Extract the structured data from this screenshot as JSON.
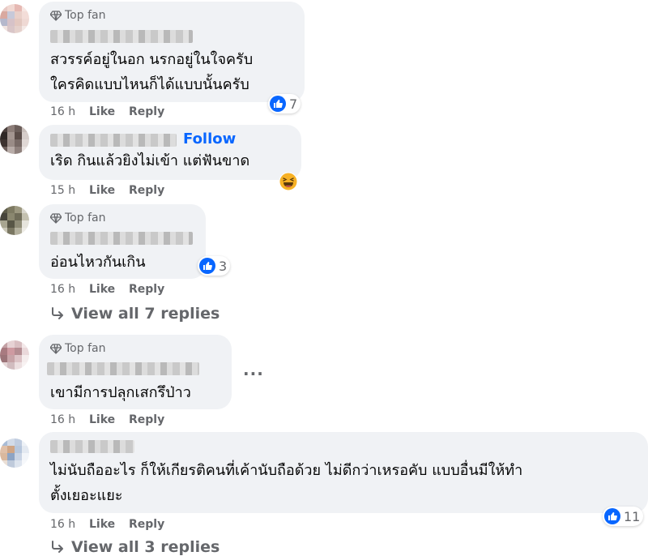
{
  "colors": {
    "bubble": "#f0f2f5",
    "accent": "#0866ff",
    "muted": "#65676b"
  },
  "comments": [
    {
      "badge": "Top fan",
      "lines": [
        "สวรรค์อยู่ในอก นรกอยู่ในใจครับ",
        "ใครคิดแบบไหนก็ได้แบบนั้นครับ"
      ],
      "time": "16 h",
      "like": "Like",
      "reply": "Reply",
      "reactions": "7"
    },
    {
      "follow": "Follow",
      "lines": [
        "เริด กินแล้วยิงไม่เข้า แต่ฟันขาด"
      ],
      "time": "15 h",
      "like": "Like",
      "reply": "Reply",
      "reaction_icon": "haha-emoji-icon"
    },
    {
      "badge": "Top fan",
      "lines": [
        "อ่อนไหวกันเกิน"
      ],
      "time": "16 h",
      "like": "Like",
      "reply": "Reply",
      "reactions": "3",
      "view_replies": "View all 7 replies"
    },
    {
      "badge": "Top fan",
      "lines": [
        "เขามีการปลุกเสกรึป่าว"
      ],
      "time": "16 h",
      "like": "Like",
      "reply": "Reply",
      "more": "..."
    },
    {
      "lines": [
        "ไม่นับถืออะไร ก็ให้เกียรติคนที่เค้านับถือด้วย ไม่ดีกว่าเหรอคับ แบบอื่นมีให้ทำ",
        "ตั้งเยอะแยะ"
      ],
      "time": "16 h",
      "like": "Like",
      "reply": "Reply",
      "reactions": "11",
      "view_replies": "View all 3 replies"
    }
  ]
}
